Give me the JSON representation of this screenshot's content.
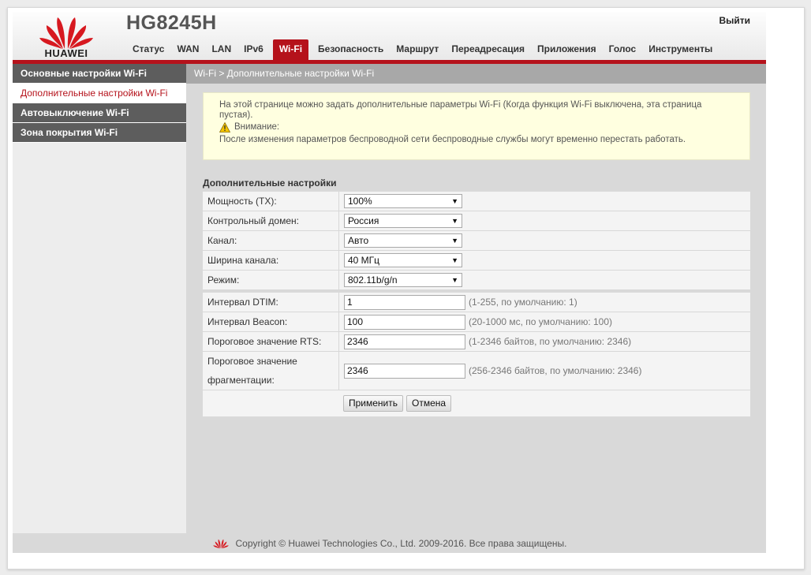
{
  "header": {
    "brand": "HUAWEI",
    "model": "HG8245H",
    "logout_label": "Выйти",
    "accent_color": "#b5121b"
  },
  "nav": {
    "items": [
      {
        "label": "Статус"
      },
      {
        "label": "WAN"
      },
      {
        "label": "LAN"
      },
      {
        "label": "IPv6"
      },
      {
        "label": "Wi-Fi",
        "active": true
      },
      {
        "label": "Безопасность"
      },
      {
        "label": "Маршрут"
      },
      {
        "label": "Переадресация"
      },
      {
        "label": "Приложения"
      },
      {
        "label": "Голос"
      },
      {
        "label": "Инструменты"
      }
    ]
  },
  "sidebar": {
    "items": [
      {
        "label": "Основные настройки Wi-Fi"
      },
      {
        "label": "Дополнительные настройки Wi-Fi",
        "active": true
      },
      {
        "label": "Автовыключение Wi-Fi"
      },
      {
        "label": "Зона покрытия Wi-Fi"
      }
    ]
  },
  "breadcrumb": "Wi-Fi > Дополнительные настройки Wi-Fi",
  "info": {
    "line1": "На этой странице можно задать дополнительные параметры Wi-Fi (Когда функция Wi-Fi выключена, эта страница",
    "line2": "пустая).",
    "warning_label": "Внимание:",
    "warning_text": "После изменения параметров беспроводной сети беспроводные службы могут временно перестать работать.",
    "warning_icon": "warning-triangle-icon"
  },
  "section_title": "Дополнительные настройки",
  "form": {
    "power": {
      "label": "Мощность (TX):",
      "value": "100%"
    },
    "domain": {
      "label": "Контрольный домен:",
      "value": "Россия"
    },
    "channel": {
      "label": "Канал:",
      "value": "Авто"
    },
    "width": {
      "label": "Ширина канала:",
      "value": "40 МГц"
    },
    "mode": {
      "label": "Режим:",
      "value": "802.11b/g/n"
    },
    "dtim": {
      "label": "Интервал DTIM:",
      "value": "1",
      "hint": "(1-255, по умолчанию: 1)"
    },
    "beacon": {
      "label": "Интервал Beacon:",
      "value": "100",
      "hint": "(20-1000 мс, по умолчанию: 100)"
    },
    "rts": {
      "label": "Пороговое значение RTS:",
      "value": "2346",
      "hint": "(1-2346 байтов, по умолчанию: 2346)"
    },
    "frag": {
      "label_line1": "Пороговое значение",
      "label_line2": "фрагментации:",
      "value": "2346",
      "hint": "(256-2346 байтов, по умолчанию: 2346)"
    }
  },
  "buttons": {
    "apply": "Применить",
    "cancel": "Отмена"
  },
  "footer": {
    "copyright": "Copyright © Huawei Technologies Co., Ltd. 2009-2016. Все права защищены."
  }
}
